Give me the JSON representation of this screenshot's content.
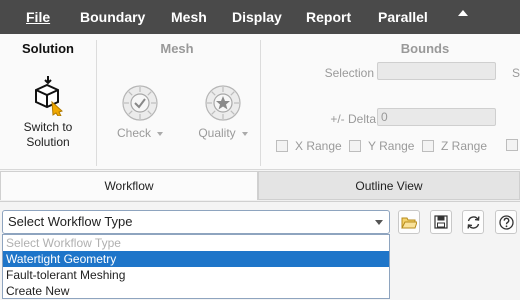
{
  "menubar": {
    "items": [
      "File",
      "Boundary",
      "Mesh",
      "Display",
      "Report",
      "Parallel"
    ]
  },
  "ribbon": {
    "solution_group": {
      "title": "Solution",
      "switch_label": "Switch to Solution"
    },
    "mesh_group": {
      "title": "Mesh",
      "check_label": "Check",
      "quality_label": "Quality"
    },
    "bounds_group": {
      "title": "Bounds",
      "selection_label": "Selection",
      "selection_value": "",
      "delta_label": "+/- Delta",
      "delta_value": "0",
      "x_range": "X Range",
      "y_range": "Y Range",
      "z_range": "Z Range",
      "cut_label": "S"
    }
  },
  "tabs": {
    "workflow": "Workflow",
    "outline": "Outline View"
  },
  "workflow": {
    "select_value": "Select Workflow Type",
    "options": [
      "Select Workflow Type",
      "Watertight Geometry",
      "Fault-tolerant Meshing",
      "Create New"
    ],
    "selected_index": 1
  },
  "colors": {
    "menubar_bg": "#4a4a4a",
    "selection_highlight": "#1e75c9",
    "switch_icon_accent": "#f0a800"
  },
  "icons": [
    "switch-to-solution-icon",
    "check-mesh-icon",
    "quality-mesh-icon",
    "open-folder-icon",
    "save-icon",
    "refresh-icon",
    "help-icon"
  ]
}
